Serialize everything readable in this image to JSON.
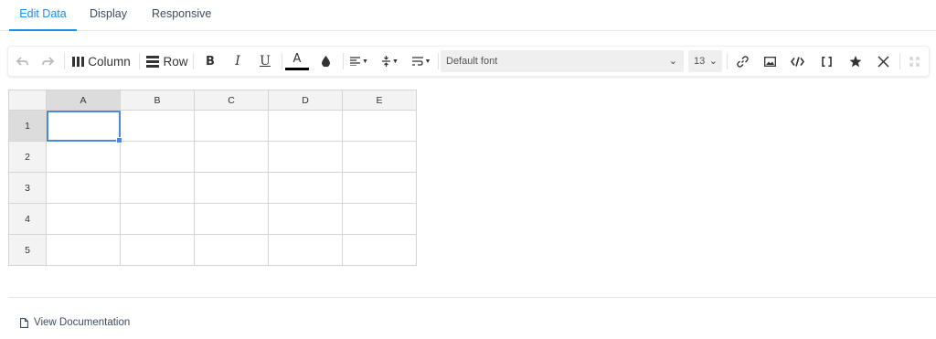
{
  "tabs": [
    {
      "label": "Edit Data",
      "active": true
    },
    {
      "label": "Display",
      "active": false
    },
    {
      "label": "Responsive",
      "active": false
    }
  ],
  "toolbar": {
    "column_label": "Column",
    "row_label": "Row",
    "bold_label": "B",
    "italic_label": "I",
    "underline_label": "U",
    "text_color_label": "A",
    "text_color": "#000000",
    "font_select_value": "Default font",
    "font_size_value": "13"
  },
  "grid": {
    "columns": [
      "A",
      "B",
      "C",
      "D",
      "E"
    ],
    "rows": [
      "1",
      "2",
      "3",
      "4",
      "5"
    ],
    "active_cell": "A1"
  },
  "footer": {
    "doc_link": "View Documentation"
  },
  "colors": {
    "accent": "#1a8fe6",
    "selection": "#4b89dc"
  }
}
